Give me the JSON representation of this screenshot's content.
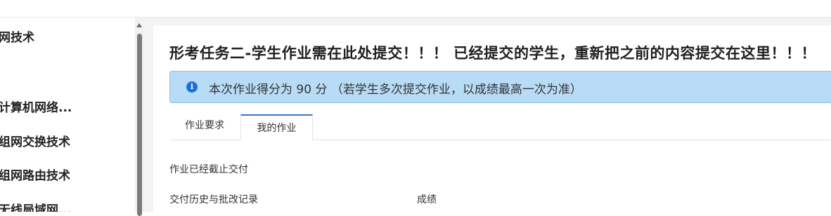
{
  "sidebar": {
    "items": [
      {
        "label": "网技术"
      },
      {
        "label": "计算机网络..."
      },
      {
        "label": "组网交换技术"
      },
      {
        "label": "组网路由技术"
      },
      {
        "label": "无线局域网..."
      }
    ]
  },
  "assignment": {
    "title": "形考任务二-学生作业需在此处提交！！！ 已经提交的学生，重新把之前的内容提交在这里！！！",
    "alert": {
      "icon": "info-icon",
      "text": "本次作业得分为 90 分 （若学生多次提交作业，以成绩最高一次为准）"
    },
    "tabs": [
      {
        "label": "作业要求",
        "active": false
      },
      {
        "label": "我的作业",
        "active": true
      }
    ],
    "status": "作业已经截止交付",
    "history_label": "交付历史与批改记录",
    "grade_label": "成绩"
  },
  "colors": {
    "alert_bg": "#b9dcf6",
    "accent": "#2f73d6"
  }
}
